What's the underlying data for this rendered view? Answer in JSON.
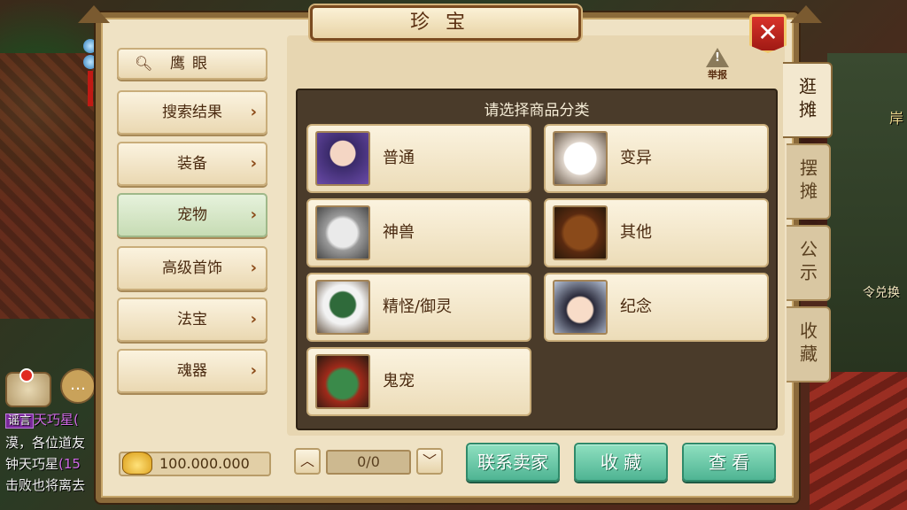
{
  "window": {
    "title": "珍宝",
    "close_label": "✕"
  },
  "sidebar": {
    "search_label": "鹰眼",
    "items": [
      {
        "label": "搜索结果",
        "active": false
      },
      {
        "label": "装备",
        "active": false
      },
      {
        "label": "宠物",
        "active": true
      },
      {
        "label": "高级首饰",
        "active": false
      },
      {
        "label": "法宝",
        "active": false
      },
      {
        "label": "魂器",
        "active": false
      }
    ]
  },
  "report": {
    "label": "举报"
  },
  "categories": {
    "heading": "请选择商品分类",
    "items": [
      {
        "label": "普通",
        "portrait": "girl-portrait"
      },
      {
        "label": "变异",
        "portrait": "white-dog-portrait"
      },
      {
        "label": "神兽",
        "portrait": "white-tiger-portrait"
      },
      {
        "label": "其他",
        "portrait": "bear-portrait"
      },
      {
        "label": "精怪/御灵",
        "portrait": "panda-mask-portrait"
      },
      {
        "label": "纪念",
        "portrait": "chibi-girl-portrait"
      },
      {
        "label": "鬼宠",
        "portrait": "green-ghost-portrait"
      }
    ]
  },
  "tabs": [
    {
      "label": "逛摊",
      "active": true
    },
    {
      "label": "摆摊",
      "active": false
    },
    {
      "label": "公示",
      "active": false
    },
    {
      "label": "收藏",
      "active": false
    }
  ],
  "footer": {
    "gold_amount": "100.000.000",
    "page_indicator": "0/0",
    "contact_label": "联系卖家",
    "favorite_label": "收 藏",
    "view_label": "查 看"
  },
  "background": {
    "chat_lines": [
      {
        "tag": "谣言",
        "name": "天巧星("
      },
      {
        "text": "漠，各位道友"
      },
      {
        "name": "钟天巧星",
        "extra": "(15"
      },
      {
        "text": "击败也将离去"
      }
    ],
    "right_text_1": "岸",
    "right_text_2": "令兑换"
  },
  "colors": {
    "panel_bg": "#efe2c4",
    "dark_box": "#4a3b2a",
    "action_green": "#4fb493",
    "close_red": "#d8332a"
  }
}
